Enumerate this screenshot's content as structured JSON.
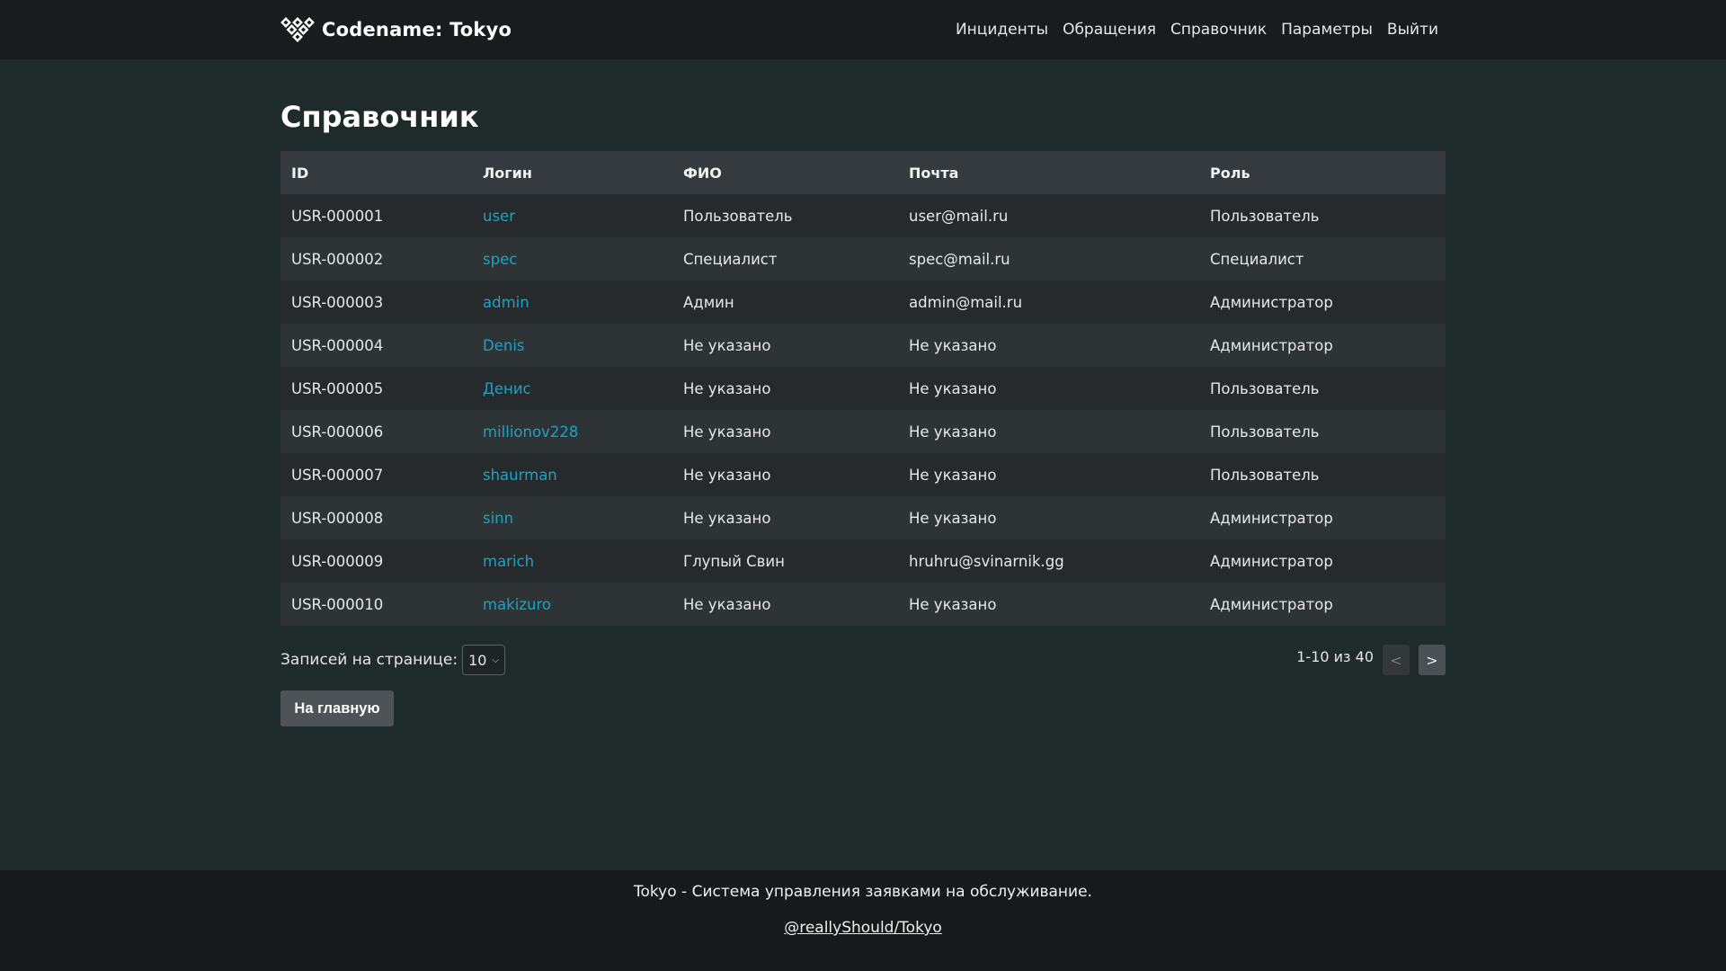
{
  "header": {
    "brand": "Codename: Tokyo",
    "brand_icon": "diamond-cluster-logo",
    "nav": [
      "Инциденты",
      "Обращения",
      "Справочник",
      "Параметры",
      "Выйти"
    ]
  },
  "page": {
    "title": "Справочник"
  },
  "table": {
    "columns": [
      "ID",
      "Логин",
      "ФИО",
      "Почта",
      "Роль"
    ],
    "rows": [
      {
        "id": "USR-000001",
        "login": "user",
        "fio": "Пользователь",
        "mail": "user@mail.ru",
        "role": "Пользователь"
      },
      {
        "id": "USR-000002",
        "login": "spec",
        "fio": "Специалист",
        "mail": "spec@mail.ru",
        "role": "Специалист"
      },
      {
        "id": "USR-000003",
        "login": "admin",
        "fio": "Админ",
        "mail": "admin@mail.ru",
        "role": "Администратор"
      },
      {
        "id": "USR-000004",
        "login": "Denis",
        "fio": "Не указано",
        "mail": "Не указано",
        "role": "Администратор"
      },
      {
        "id": "USR-000005",
        "login": "Денис",
        "fio": "Не указано",
        "mail": "Не указано",
        "role": "Пользователь"
      },
      {
        "id": "USR-000006",
        "login": "millionov228",
        "fio": "Не указано",
        "mail": "Не указано",
        "role": "Пользователь"
      },
      {
        "id": "USR-000007",
        "login": "shaurman",
        "fio": "Не указано",
        "mail": "Не указано",
        "role": "Пользователь"
      },
      {
        "id": "USR-000008",
        "login": "sinn",
        "fio": "Не указано",
        "mail": "Не указано",
        "role": "Администратор"
      },
      {
        "id": "USR-000009",
        "login": "marich",
        "fio": "Глупый Свин",
        "mail": "hruhru@svinarnik.gg",
        "role": "Администратор"
      },
      {
        "id": "USR-000010",
        "login": "makizuro",
        "fio": "Не указано",
        "mail": "Не указано",
        "role": "Администратор"
      }
    ]
  },
  "pagination": {
    "per_page_label": "Записей на странице:",
    "per_page_value": "10",
    "range_text": "1-10 из 40",
    "prev_label": "<",
    "next_label": ">"
  },
  "actions": {
    "home_label": "На главную"
  },
  "footer": {
    "text": "Tokyo - Система управления заявками на обслуживание.",
    "link": "@reallyShould/Tokyo"
  },
  "colors": {
    "background": "#1f2a2b",
    "header_bg": "#181c1e",
    "link": "#1aa3c7",
    "table_header_bg": "#343a3d"
  }
}
